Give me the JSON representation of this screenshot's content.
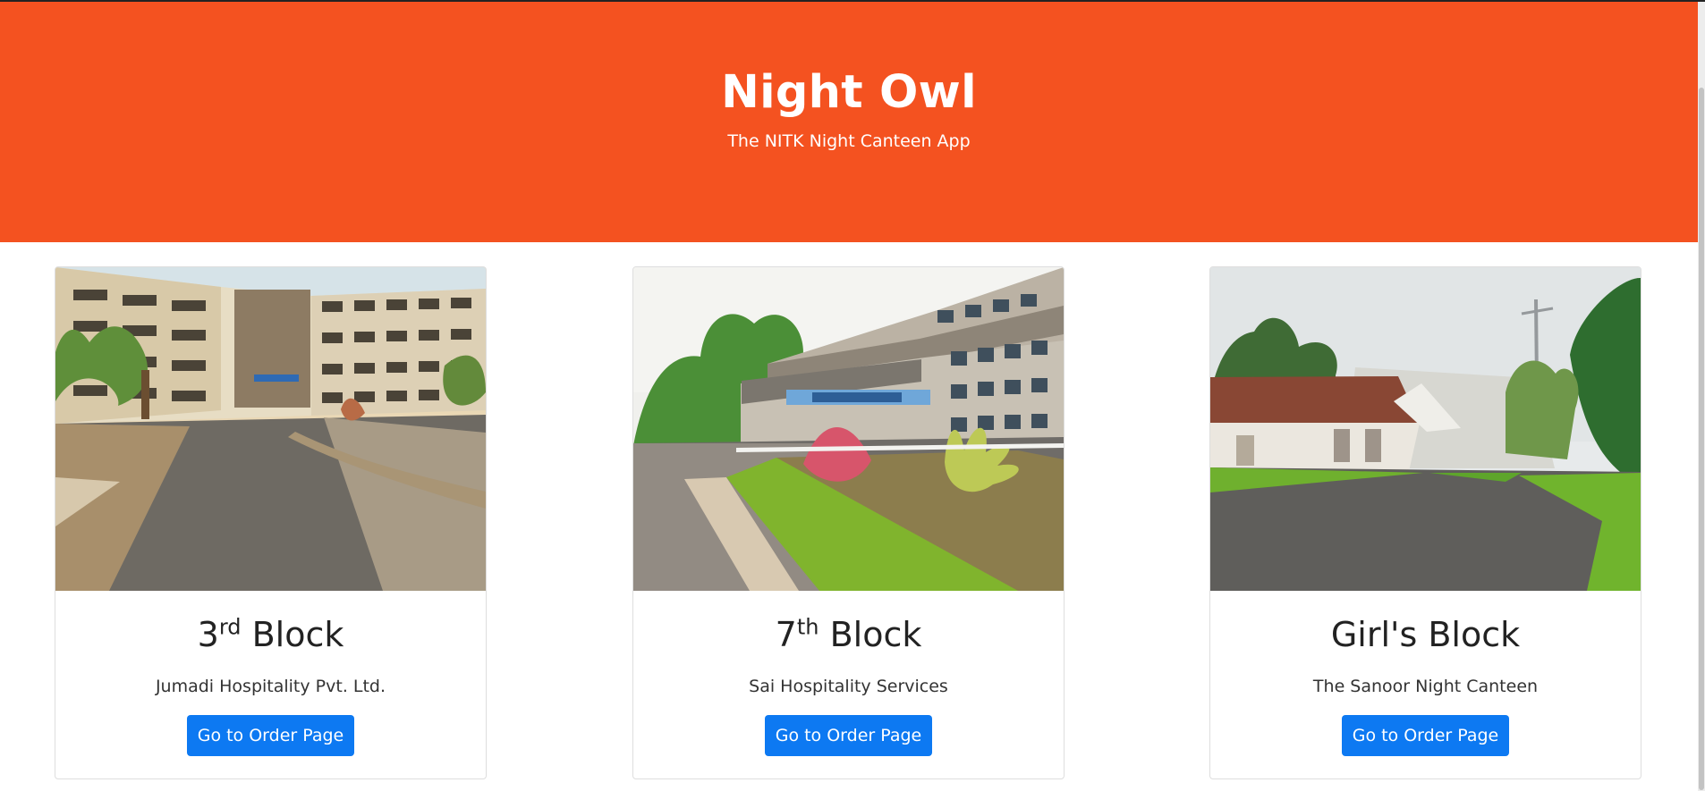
{
  "header": {
    "title": "Night Owl",
    "subtitle": "The NITK Night Canteen App",
    "background_color": "#f45220"
  },
  "cards": [
    {
      "block_number": "3",
      "block_suffix": "rd",
      "block_label": "Block",
      "company": "Jumadi Hospitality Pvt. Ltd.",
      "button_label": "Go to Order Page",
      "image_alt": "Building photo of 3rd block"
    },
    {
      "block_number": "7",
      "block_suffix": "th",
      "block_label": "Block",
      "company": "Sai Hospitality Services",
      "button_label": "Go to Order Page",
      "image_alt": "Building photo of 7th block"
    },
    {
      "block_number": "",
      "block_suffix": "",
      "block_label": "Girl's Block",
      "company": "The Sanoor Night Canteen",
      "button_label": "Go to Order Page",
      "image_alt": "Building photo of Girl's Block"
    }
  ],
  "button_color": "#0d79f2"
}
